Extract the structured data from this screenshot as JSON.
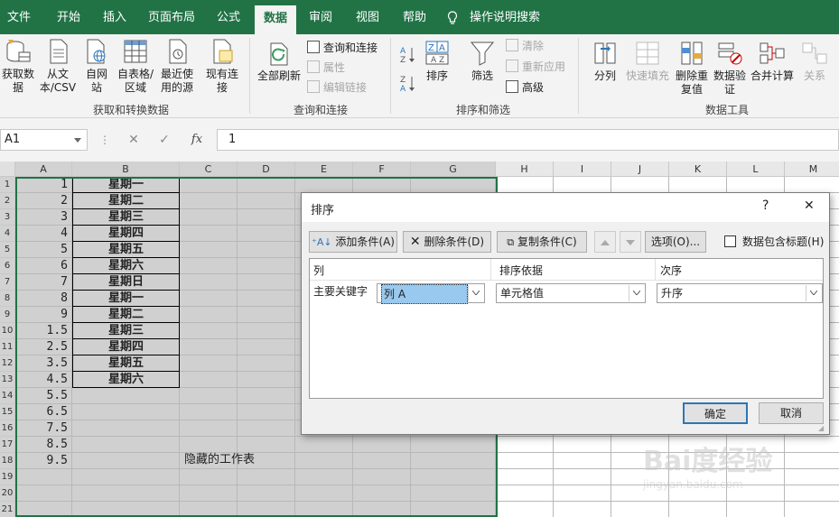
{
  "tabs": [
    "文件",
    "开始",
    "插入",
    "页面布局",
    "公式",
    "数据",
    "审阅",
    "视图",
    "帮助"
  ],
  "tell_me": "操作说明搜索",
  "ribbon": {
    "get_data": "获取数据",
    "from_text": "从文本/CSV",
    "from_web": "自网站",
    "from_table": "自表格/区域",
    "recent_sources": "最近使用的源",
    "existing_conn": "现有连接",
    "refresh_all": "全部刷新",
    "queries_conn": "查询和连接",
    "properties": "属性",
    "edit_links": "编辑链接",
    "sort": "排序",
    "filter": "筛选",
    "clear": "清除",
    "reapply": "重新应用",
    "advanced": "高级",
    "text_to_cols": "分列",
    "flash_fill": "快速填充",
    "remove_dup": "删除重复值",
    "data_validation": "数据验证",
    "consolidate": "合并计算",
    "relationships": "关系",
    "group_get": "获取和转换数据",
    "group_queries": "查询和连接",
    "group_sort": "排序和筛选",
    "group_tools": "数据工具"
  },
  "formula_bar": {
    "name_box": "A1",
    "cancel": "✕",
    "enter": "✓",
    "fx": "fx",
    "value": "1"
  },
  "columns": [
    "A",
    "B",
    "C",
    "D",
    "E",
    "F",
    "G",
    "H",
    "I",
    "J",
    "K",
    "L",
    "M"
  ],
  "rows": [
    "1",
    "2",
    "3",
    "4",
    "5",
    "6",
    "7",
    "8",
    "9",
    "10",
    "11",
    "12",
    "13",
    "14",
    "15",
    "16",
    "17",
    "18",
    "19",
    "20",
    "21"
  ],
  "col_a_values": [
    "1",
    "2",
    "3",
    "4",
    "5",
    "6",
    "7",
    "8",
    "9",
    "1.5",
    "2.5",
    "3.5",
    "4.5",
    "5.5",
    "6.5",
    "7.5",
    "8.5",
    "9.5"
  ],
  "col_b_values": [
    "星期一",
    "星期二",
    "星期三",
    "星期四",
    "星期五",
    "星期六",
    "星期日",
    "星期一",
    "星期二",
    "星期三",
    "星期四",
    "星期五",
    "星期六"
  ],
  "hidden_sheet_text": "隐藏的工作表",
  "dialog": {
    "title": "排序",
    "help": "?",
    "close": "✕",
    "add_level": "添加条件(A)",
    "delete_level": "删除条件(D)",
    "copy_level": "复制条件(C)",
    "options": "选项(O)...",
    "has_headers": "数据包含标题(H)",
    "col_header": "列",
    "sort_on_header": "排序依据",
    "order_header": "次序",
    "row_label": "主要关键字",
    "column_value": "列 A",
    "sort_on_value": "单元格值",
    "order_value": "升序",
    "ok": "确定",
    "cancel": "取消"
  },
  "watermark": {
    "brand": "Bai度经验",
    "url": "jingyan.baidu.com"
  },
  "colors": {
    "excel_green": "#217346",
    "selection_gray": "#d0d0d0",
    "combo_highlight": "#99c9ef"
  }
}
